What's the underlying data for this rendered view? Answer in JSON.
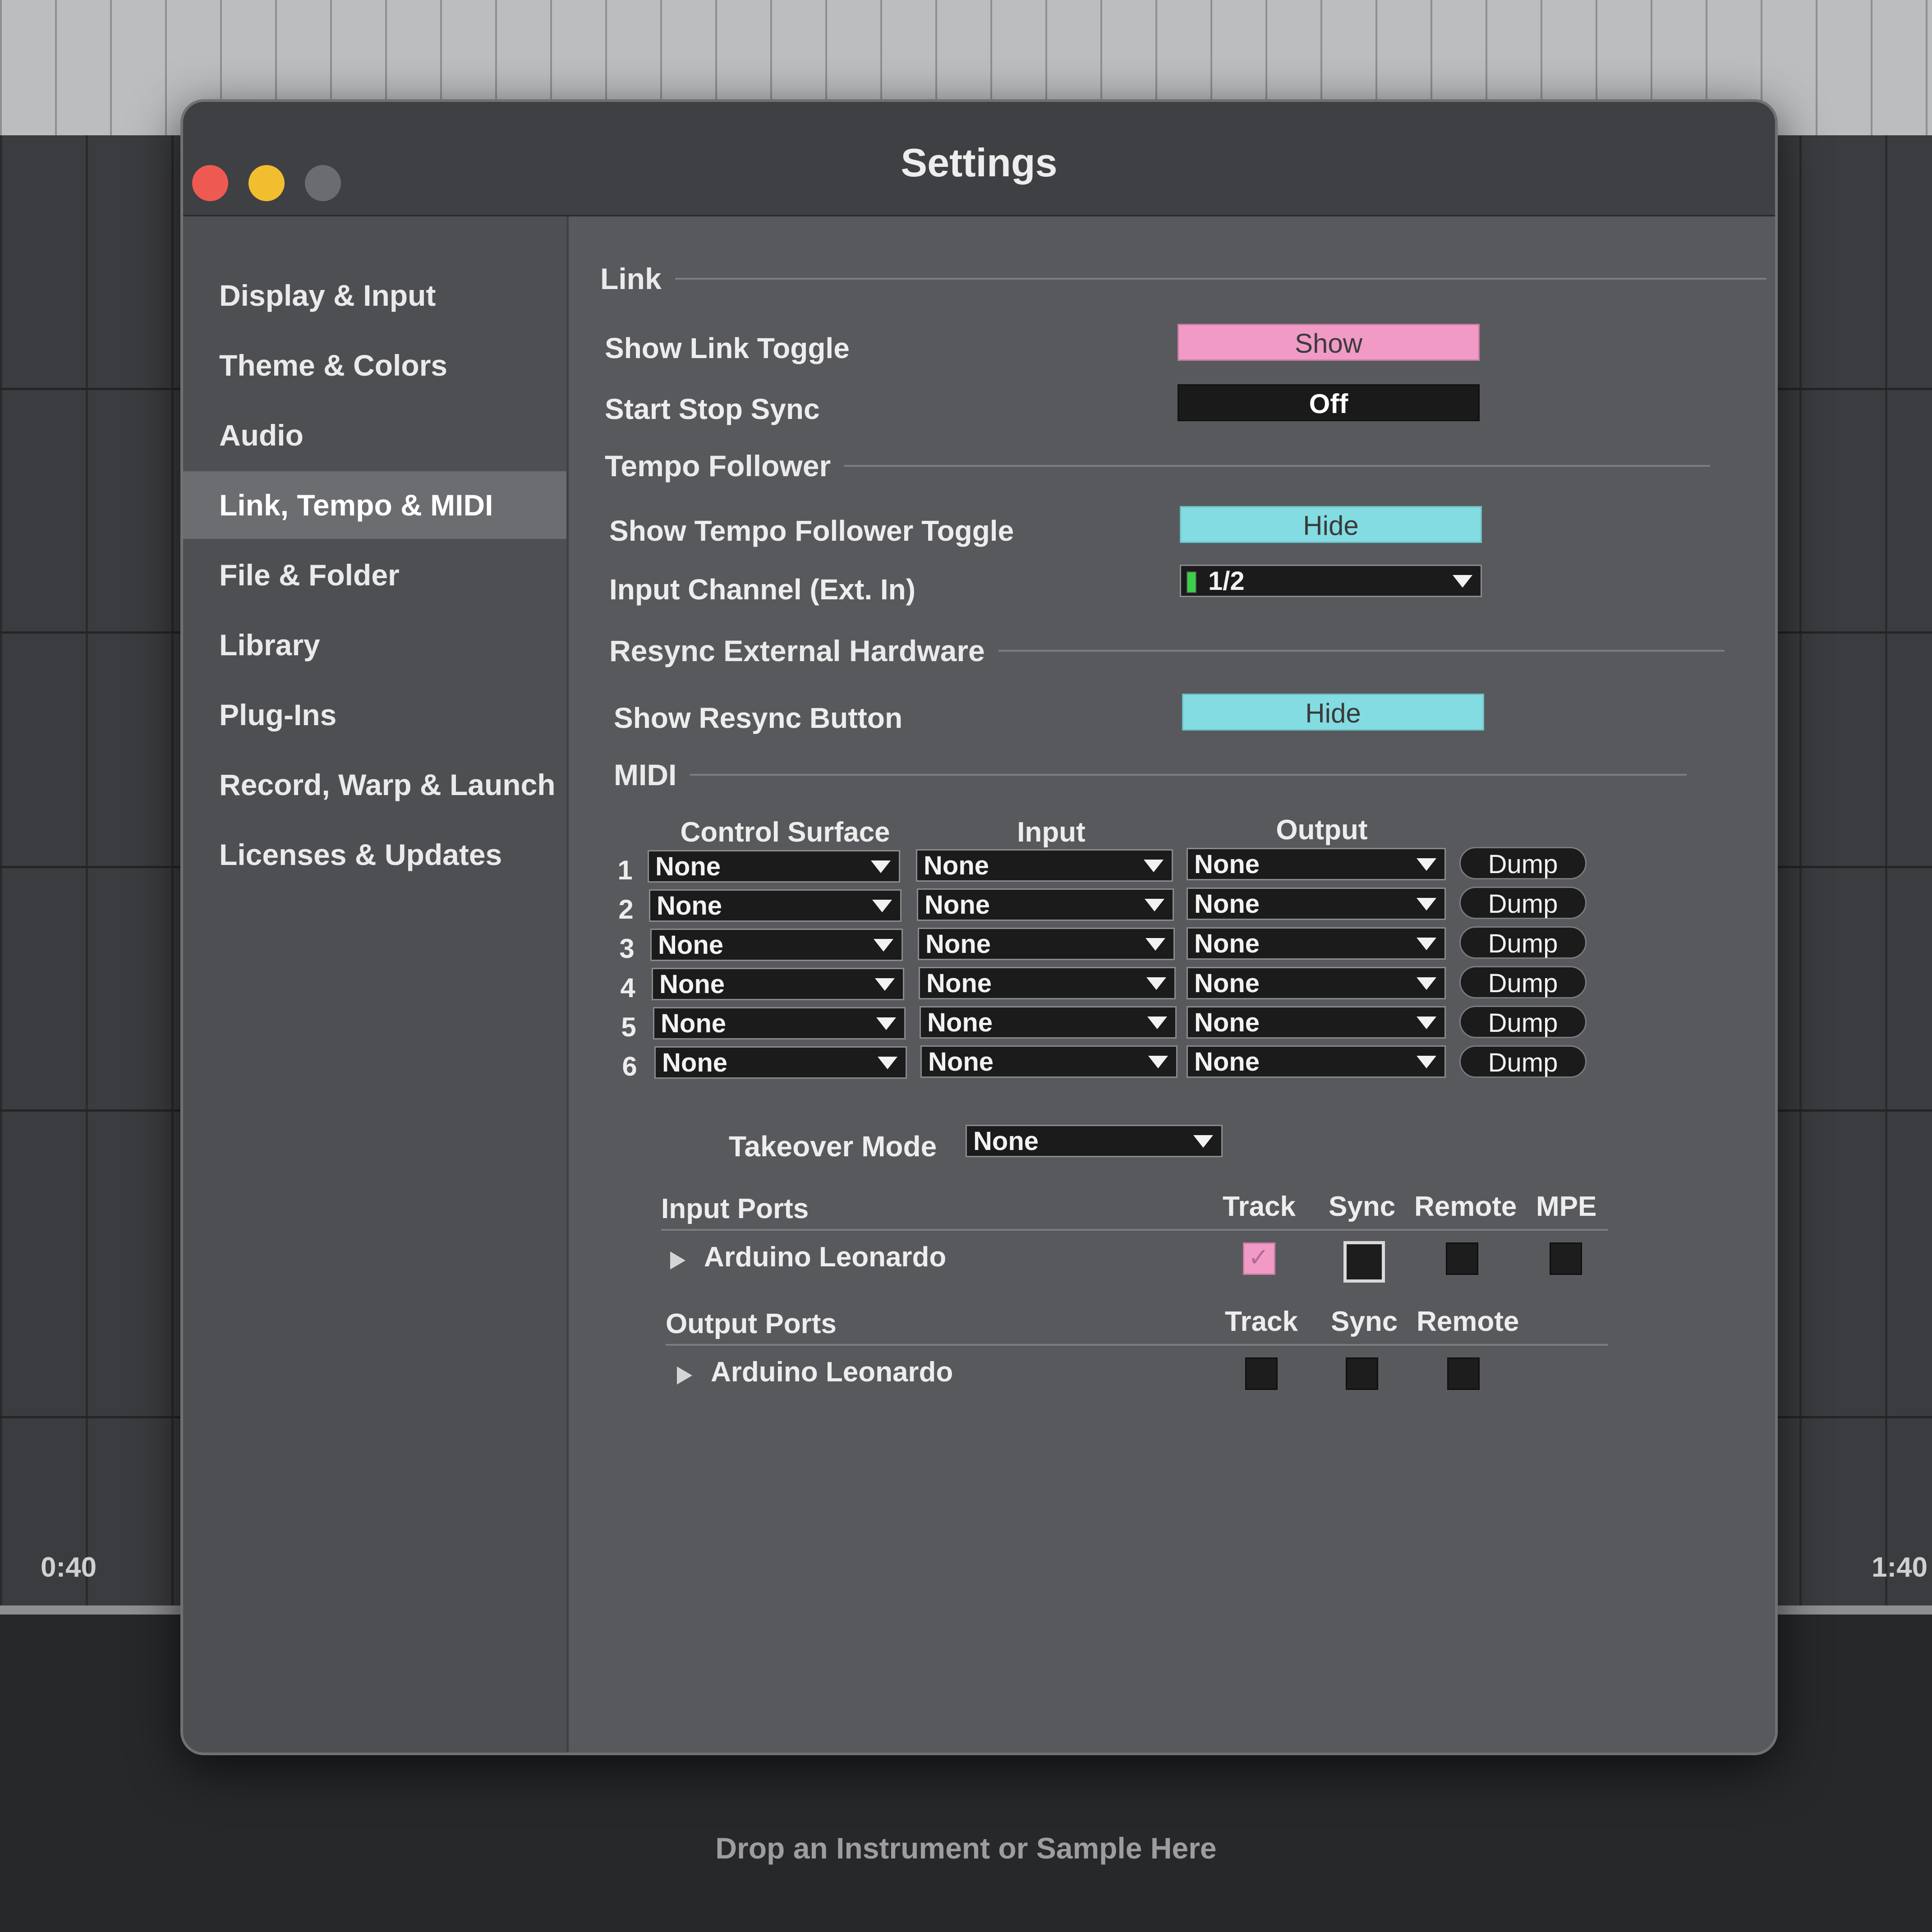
{
  "window": {
    "title": "Settings"
  },
  "sidebar": {
    "items": [
      {
        "label": "Display & Input"
      },
      {
        "label": "Theme & Colors"
      },
      {
        "label": "Audio"
      },
      {
        "label": "Link, Tempo & MIDI",
        "active": true
      },
      {
        "label": "File & Folder"
      },
      {
        "label": "Library"
      },
      {
        "label": "Plug-Ins"
      },
      {
        "label": "Record, Warp & Launch"
      },
      {
        "label": "Licenses & Updates"
      }
    ]
  },
  "link": {
    "section_title": "Link",
    "show_link_toggle": {
      "label": "Show Link Toggle",
      "value": "Show"
    },
    "start_stop_sync": {
      "label": "Start Stop Sync",
      "value": "Off"
    }
  },
  "tempo_follower": {
    "section_title": "Tempo Follower",
    "show_toggle": {
      "label": "Show Tempo Follower Toggle",
      "value": "Hide"
    },
    "input_channel": {
      "label": "Input Channel (Ext. In)",
      "value": "1/2"
    }
  },
  "resync": {
    "section_title": "Resync External Hardware",
    "show_button": {
      "label": "Show Resync Button",
      "value": "Hide"
    }
  },
  "midi": {
    "section_title": "MIDI",
    "headers": {
      "control_surface": "Control Surface",
      "input": "Input",
      "output": "Output"
    },
    "rows": [
      {
        "num": "1",
        "control_surface": "None",
        "input": "None",
        "output": "None",
        "dump": "Dump"
      },
      {
        "num": "2",
        "control_surface": "None",
        "input": "None",
        "output": "None",
        "dump": "Dump"
      },
      {
        "num": "3",
        "control_surface": "None",
        "input": "None",
        "output": "None",
        "dump": "Dump"
      },
      {
        "num": "4",
        "control_surface": "None",
        "input": "None",
        "output": "None",
        "dump": "Dump"
      },
      {
        "num": "5",
        "control_surface": "None",
        "input": "None",
        "output": "None",
        "dump": "Dump"
      },
      {
        "num": "6",
        "control_surface": "None",
        "input": "None",
        "output": "None",
        "dump": "Dump"
      }
    ],
    "takeover_mode": {
      "label": "Takeover Mode",
      "value": "None"
    }
  },
  "input_ports": {
    "title": "Input Ports",
    "columns": [
      "Track",
      "Sync",
      "Remote",
      "MPE"
    ],
    "ports": [
      {
        "name": "Arduino Leonardo",
        "track": true,
        "sync": false,
        "remote": false,
        "mpe": false
      }
    ]
  },
  "output_ports": {
    "title": "Output Ports",
    "columns": [
      "Track",
      "Sync",
      "Remote"
    ],
    "ports": [
      {
        "name": "Arduino Leonardo",
        "track": false,
        "sync": false,
        "remote": false
      }
    ]
  },
  "background": {
    "time_left": "0:40",
    "time_right": "1:40",
    "drop_hint": "Drop an Instrument or Sample Here"
  },
  "colors": {
    "toggle_pink": "#f19ac6",
    "toggle_cyan": "#83dce2",
    "close_red": "#ee5a52",
    "minimize_yellow": "#f1be2f"
  },
  "icons": {
    "checkmark": "checkmark-icon",
    "dropdown": "chevron-down-icon",
    "disclosure": "disclosure-triangle-icon"
  }
}
